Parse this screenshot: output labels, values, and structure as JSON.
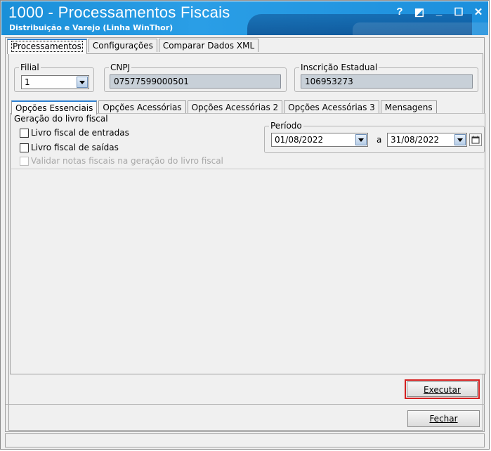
{
  "window": {
    "title": "1000 - Processamentos Fiscais",
    "subtitle": "Distribuição e Varejo (Linha WinThor)",
    "controls": [
      "?",
      "◩",
      "_",
      "☐",
      "✕"
    ]
  },
  "top_tabs": [
    {
      "label": "Processamentos",
      "active": true
    },
    {
      "label": "Configurações",
      "active": false
    },
    {
      "label": "Comparar Dados XML",
      "active": false
    }
  ],
  "filial": {
    "legend": "Filial",
    "value": "1"
  },
  "cnpj": {
    "legend": "CNPJ",
    "value": "07577599000501"
  },
  "inscricao": {
    "legend": "Inscrição Estadual",
    "value": "106953273"
  },
  "inner_tabs": [
    {
      "label": "Opções Essenciais",
      "active": true
    },
    {
      "label": "Opções Acessórias",
      "active": false
    },
    {
      "label": "Opções Acessórias 2",
      "active": false
    },
    {
      "label": "Opções Acessórias 3",
      "active": false
    },
    {
      "label": "Mensagens",
      "active": false
    }
  ],
  "geracao": {
    "label": "Geração do livro fiscal",
    "items": [
      {
        "label": "Livro fiscal de entradas",
        "checked": false,
        "enabled": true
      },
      {
        "label": "Livro fiscal de saídas",
        "checked": false,
        "enabled": true
      },
      {
        "label": "Validar notas fiscais na geração do livro fiscal",
        "checked": false,
        "enabled": false
      }
    ]
  },
  "periodo": {
    "legend": "Período",
    "start": "01/08/2022",
    "separator": "a",
    "end": "31/08/2022"
  },
  "buttons": {
    "executar": "Executar",
    "fechar": "Fechar"
  },
  "colors": {
    "titlebar": "#1a8fd8",
    "highlight": "#d42020",
    "readonly_field": "#c8d0d8"
  }
}
